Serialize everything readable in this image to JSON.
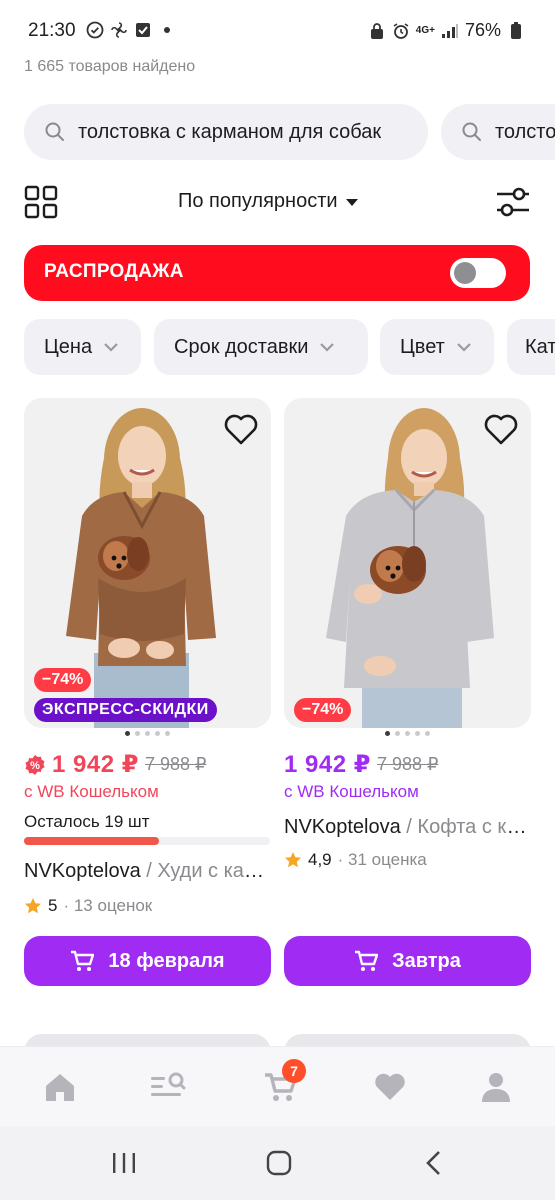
{
  "status_bar": {
    "time": "21:30",
    "network": "4G+",
    "battery": "76%"
  },
  "results": {
    "found_text": "1 665 товаров найдено"
  },
  "search_chips": [
    {
      "text": "толстовка с карманом для собак",
      "icon": "search-icon"
    },
    {
      "text": "толсто",
      "icon": "search-icon"
    }
  ],
  "sort": {
    "label": "По популярности"
  },
  "sale_banner": {
    "label": "РАСПРОДАЖА",
    "toggle_on": false,
    "color": "#ff0d1e"
  },
  "filter_chips": [
    {
      "label": "Цена"
    },
    {
      "label": "Срок доставки"
    },
    {
      "label": "Цвет"
    },
    {
      "label": "Кат"
    }
  ],
  "products": [
    {
      "discount": "−74%",
      "badge": "ЭКСПРЕСС-СКИДКИ",
      "price": "1 942 ₽",
      "old_price": "7 988 ₽",
      "wallet_text": "с WB Кошельком",
      "stock_text": "Осталось 19 шт",
      "stock_fraction": 0.55,
      "brand": "NVKoptelova",
      "separator": " / ",
      "name": "Худи с карманом",
      "rating": "5",
      "reviews": "· 13 оценок",
      "button_label": "18 февраля",
      "price_color": "#f0465a",
      "sweater_color": "#a06a45"
    },
    {
      "discount": "−74%",
      "price": "1 942 ₽",
      "old_price": "7 988 ₽",
      "wallet_text": "с WB Кошельком",
      "brand": "NVKoptelova",
      "separator": " / ",
      "name": "Кофта с карманом",
      "rating": "4,9",
      "reviews": "· 31 оценка",
      "button_label": "Завтра",
      "price_color": "#a02cf3",
      "sweater_color": "#c8c8cc"
    }
  ],
  "bottom_nav": {
    "cart_badge": "7",
    "items": [
      "home-icon",
      "catalog-search-icon",
      "cart-icon",
      "heart-icon",
      "profile-icon"
    ]
  },
  "colors": {
    "accent": "#a02cf3",
    "sale_red": "#ff0d1e",
    "discount_red": "#ff3b45"
  }
}
